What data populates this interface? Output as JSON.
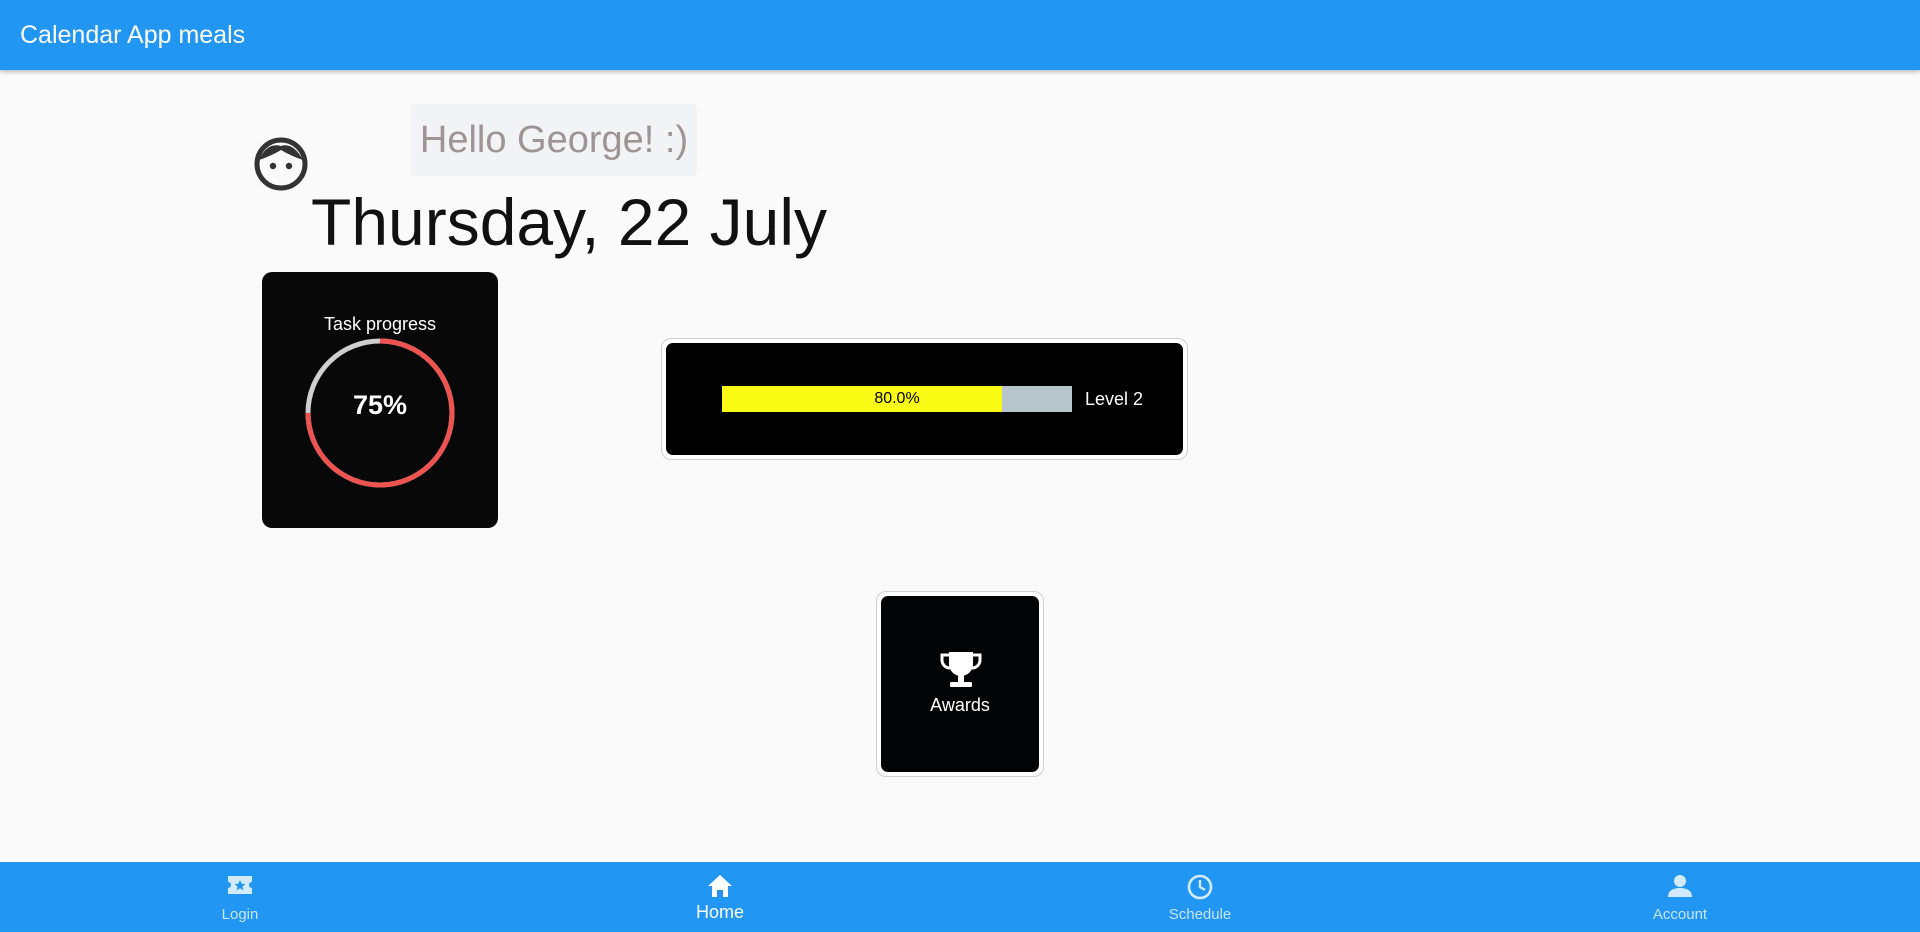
{
  "appbar": {
    "title": "Calendar App meals"
  },
  "header": {
    "greeting": "Hello George! :)",
    "date": "Thursday, 22 July",
    "avatar_icon": "face-icon"
  },
  "task_progress": {
    "label": "Task progress",
    "value_text": "75%",
    "progress": 0.75,
    "ring_color": "#ef5350",
    "track_color": "#cfcfcf"
  },
  "level": {
    "progress_text": "80.0%",
    "progress": 0.8,
    "label": "Level 2",
    "fill_color": "#fafb15",
    "track_color": "#b8c4cb"
  },
  "awards": {
    "label": "Awards",
    "icon": "trophy-icon"
  },
  "bottom_nav": {
    "items": [
      {
        "label": "Login",
        "icon": "ticket-icon",
        "active": false
      },
      {
        "label": "Home",
        "icon": "home-icon",
        "active": true
      },
      {
        "label": "Schedule",
        "icon": "clock-icon",
        "active": false
      },
      {
        "label": "Account",
        "icon": "person-icon",
        "active": false
      }
    ]
  },
  "colors": {
    "primary": "#2196f3",
    "background": "#fafafa",
    "card": "#080808"
  }
}
